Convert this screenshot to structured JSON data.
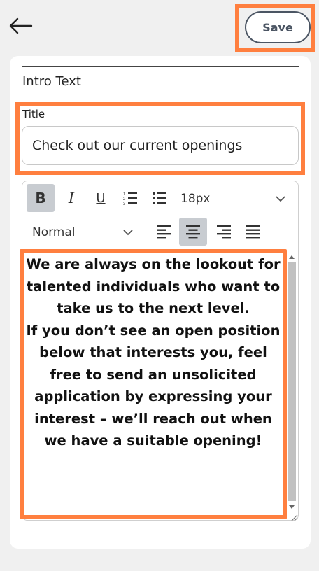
{
  "header": {
    "save_label": "Save"
  },
  "section": {
    "title": "Intro Text"
  },
  "title_field": {
    "label": "Title",
    "value": "Check out our current openings"
  },
  "toolbar": {
    "bold": "B",
    "italic": "I",
    "underline": "U",
    "font_size": "18px",
    "block_format": "Normal"
  },
  "editor": {
    "paragraphs": [
      "We are always on the lookout for talented individuals who want to take us to the next level.",
      "If you don’t see an open position below that interests you, feel free to send an unsolicited application by expressing your interest – we’ll reach out when we have a suitable opening!"
    ]
  },
  "colors": {
    "highlight": "#ff7f3f",
    "button_border": "#4b5563",
    "active_tool": "#c8ccd1"
  },
  "icons": [
    "back-arrow-icon",
    "bold-icon",
    "italic-icon",
    "underline-icon",
    "ordered-list-icon",
    "bullet-list-icon",
    "chevron-down-icon",
    "align-left-icon",
    "align-center-icon",
    "align-right-icon",
    "align-justify-icon",
    "resize-handle-icon"
  ]
}
